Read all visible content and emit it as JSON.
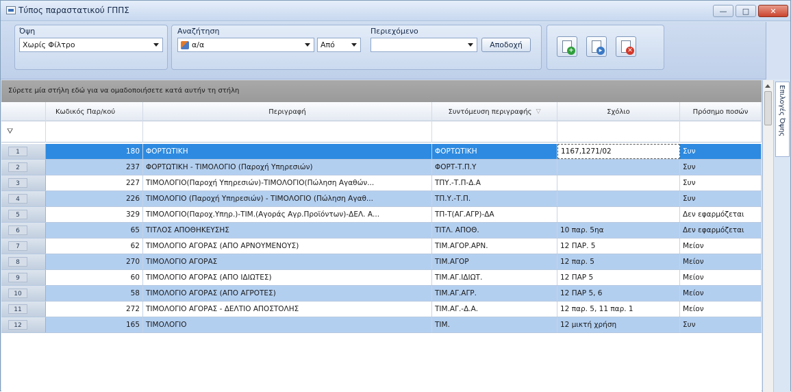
{
  "window": {
    "title": "Τύπος παραστατικού ΓΠΠΣ",
    "minimize": "—",
    "maximize": "□",
    "close": "✕"
  },
  "toolbar": {
    "view_label": "Όψη",
    "view_value": "Χωρίς Φίλτρο",
    "search_label": "Αναζήτηση",
    "search_field": "α/α",
    "operator": "Από",
    "contains_label": "Περιεχόμενο",
    "contains_value": "",
    "accept_label": "Αποδοχή",
    "actions": [
      {
        "name": "new-document-icon",
        "color": "#2e9e3b",
        "glyph": "+"
      },
      {
        "name": "copy-document-icon",
        "color": "#3a78c5",
        "glyph": "▸"
      },
      {
        "name": "delete-document-icon",
        "color": "#d2382a",
        "glyph": "✕"
      }
    ]
  },
  "grid": {
    "group_hint": "Σύρετε μία στήλη εδώ για να ομαδοποιήσετε κατά αυτήν τη στήλη",
    "columns": [
      {
        "label": "Κωδικός Παρ/κού"
      },
      {
        "label": "Περιγραφή"
      },
      {
        "label": "Συντόμευση περιγραφής"
      },
      {
        "label": "Σχόλιο"
      },
      {
        "label": "Πρόσημο ποσών"
      }
    ],
    "rows": [
      {
        "n": "1",
        "code": "180",
        "desc": "ΦΟΡΤΩΤΙΚΗ",
        "short": "ΦΟΡΤΩΤΙΚΗ",
        "comment": "1167,1271/02",
        "sign": "Συν"
      },
      {
        "n": "2",
        "code": "237",
        "desc": "ΦΟΡΤΩΤΙΚΗ - ΤΙΜΟΛΟΓΙΟ (Παροχή Υπηρεσιών)",
        "short": "ΦΟΡΤ-Τ.Π.Υ",
        "comment": "",
        "sign": "Συν"
      },
      {
        "n": "3",
        "code": "227",
        "desc": "ΤΙΜΟΛΟΓΙΟ(Παροχή Υπηρεσιών)-ΤΙΜΟΛΟΓΙΟ(Πώληση Αγαθών...",
        "short": "ΤΠΥ.-Τ.Π-Δ.Α",
        "comment": "",
        "sign": "Συν"
      },
      {
        "n": "4",
        "code": "226",
        "desc": "ΤΙΜΟΛΟΓΙΟ (Παροχή Υπηρεσιών) - ΤΙΜΟΛΟΓΙΟ (Πώληση Αγαθ...",
        "short": "ΤΠ.Υ.-Τ.Π.",
        "comment": "",
        "sign": "Συν"
      },
      {
        "n": "5",
        "code": "329",
        "desc": "ΤΙΜΟΛΟΓΙΟ(Παροχ.Υπηρ.)-ΤΙΜ.(Αγοράς Αγρ.Προϊόντων)-ΔΕΛ. Α...",
        "short": "ΤΠ-Τ(ΑΓ.ΑΓΡ)-ΔΑ",
        "comment": "",
        "sign": "Δεν εφαρμόζεται"
      },
      {
        "n": "6",
        "code": "65",
        "desc": "ΤΙΤΛΟΣ ΑΠΟΘΗΚΕΥΣΗΣ",
        "short": "ΤΙΤΛ. ΑΠΟΘ.",
        "comment": "10 παρ. 5ηα",
        "sign": "Δεν εφαρμόζεται"
      },
      {
        "n": "7",
        "code": "62",
        "desc": "ΤΙΜΟΛΟΓΙΟ ΑΓΟΡΑΣ (ΑΠΟ ΑΡΝΟΥΜΕΝΟΥΣ)",
        "short": "ΤΙΜ.ΑΓΟΡ.ΑΡΝ.",
        "comment": "12 ΠΑΡ. 5",
        "sign": "Μείον"
      },
      {
        "n": "8",
        "code": "270",
        "desc": "ΤΙΜΟΛΟΓΙΟ ΑΓΟΡΑΣ",
        "short": "ΤΙΜ.ΑΓΟΡ",
        "comment": "12 παρ. 5",
        "sign": "Μείον"
      },
      {
        "n": "9",
        "code": "60",
        "desc": "ΤΙΜΟΛΟΓΙΟ ΑΓΟΡΑΣ (ΑΠΟ ΙΔΙΩΤΕΣ)",
        "short": "ΤΙΜ.ΑΓ.ΙΔΙΩΤ.",
        "comment": "12 ΠΑΡ 5",
        "sign": "Μείον"
      },
      {
        "n": "10",
        "code": "58",
        "desc": "ΤΙΜΟΛΟΓΙΟ ΑΓΟΡΑΣ (ΑΠΟ ΑΓΡΟΤΕΣ)",
        "short": "ΤΙΜ.ΑΓ.ΑΓΡ.",
        "comment": "12 ΠΑΡ 5, 6",
        "sign": "Μείον"
      },
      {
        "n": "11",
        "code": "272",
        "desc": "ΤΙΜΟΛΟΓΙΟ ΑΓΟΡΑΣ - ΔΕΛΤΙΟ ΑΠΟΣΤΟΛΗΣ",
        "short": "ΤΙΜ.ΑΓ.-Δ.Α.",
        "comment": "12 παρ. 5, 11 παρ. 1",
        "sign": "Μείον"
      },
      {
        "n": "12",
        "code": "165",
        "desc": "ΤΙΜΟΛΟΓΙΟ",
        "short": "ΤΙΜ.",
        "comment": "12 μικτή χρήση",
        "sign": "Συν"
      }
    ]
  },
  "side_panel": {
    "tab_label": "Επιλογές Όψης"
  },
  "icons": {
    "filter": "funnel-icon",
    "sort": "sort-descending-icon"
  }
}
